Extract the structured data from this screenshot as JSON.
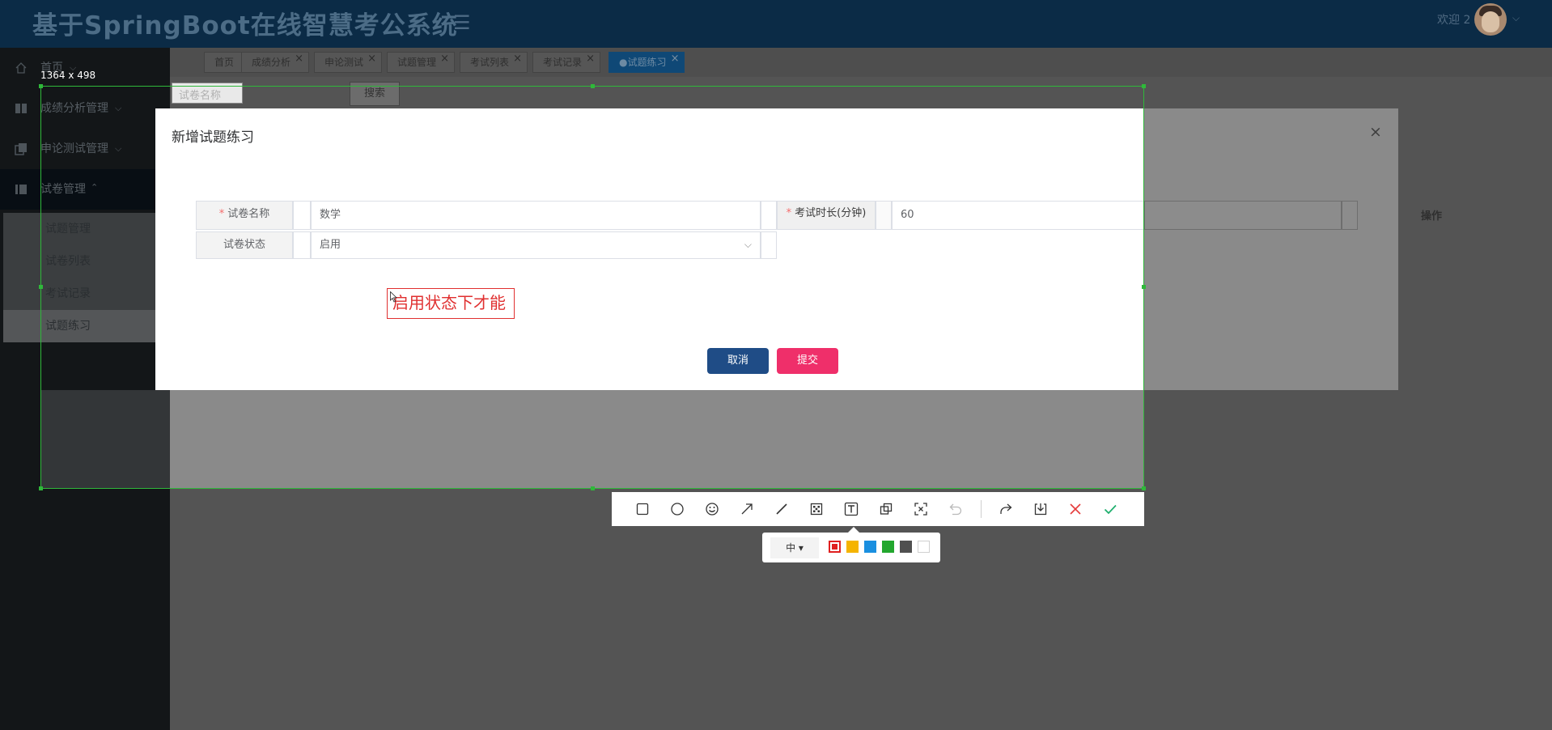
{
  "app": {
    "title": "基于SpringBoot在线智慧考公系统",
    "welcome": "欢迎 2"
  },
  "sidebar": {
    "home": "首页",
    "groups": [
      {
        "label": "成绩分析管理"
      },
      {
        "label": "申论测试管理"
      },
      {
        "label": "试卷管理"
      }
    ],
    "exam_sub_items": [
      "试题管理",
      "试卷列表",
      "考试记录",
      "试题练习"
    ]
  },
  "tabs": [
    {
      "label": "首页",
      "closable": false
    },
    {
      "label": "成绩分析",
      "closable": true
    },
    {
      "label": "申论测试",
      "closable": true
    },
    {
      "label": "试题管理",
      "closable": true
    },
    {
      "label": "考试列表",
      "closable": true
    },
    {
      "label": "考试记录",
      "closable": true
    },
    {
      "label": "●试题练习",
      "closable": true,
      "active": true
    }
  ],
  "search": {
    "placeholder": "试卷名称",
    "button": "搜索"
  },
  "background_table": {
    "op_header": "操作"
  },
  "dialog": {
    "title": "新增试题练习",
    "close": "×",
    "fields": {
      "name_label": "试卷名称",
      "name_value": "数学",
      "duration_label": "考试时长(分钟)",
      "duration_value": "60",
      "status_label": "试卷状态",
      "status_value": "启用"
    },
    "required_mark": "*",
    "cancel": "取消",
    "submit": "提交"
  },
  "screenshot_tool": {
    "size_label": "1364 x 498",
    "annotation_text": "启用状态下才能",
    "brush_size": "中",
    "tools": [
      "rectangle-icon",
      "ellipse-icon",
      "emoji-icon",
      "arrow-icon",
      "line-icon",
      "mosaic-icon",
      "text-icon",
      "pin-icon",
      "ocr-icon",
      "undo-icon",
      "redo-icon",
      "save-icon",
      "cancel-icon",
      "confirm-icon"
    ],
    "colors": [
      "#e02020",
      "#f5b400",
      "#1a8fe0",
      "#23a72e",
      "#505050",
      "#ffffff"
    ]
  }
}
